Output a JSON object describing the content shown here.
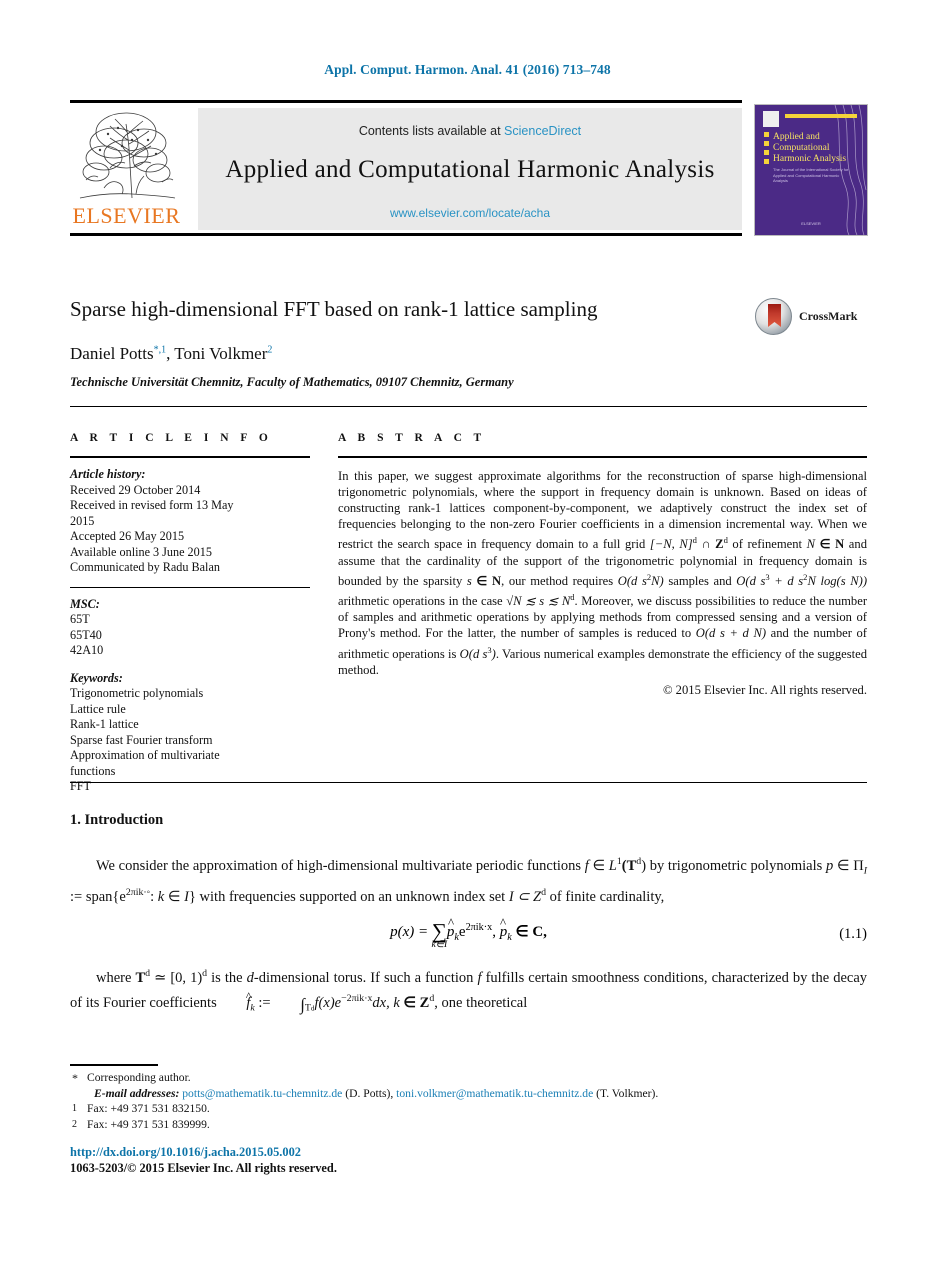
{
  "running_head": "Appl. Comput. Harmon. Anal. 41 (2016) 713–748",
  "masthead": {
    "contents_prefix": "Contents lists available at ",
    "contents_link": "ScienceDirect",
    "journal_title": "Applied and Computational Harmonic Analysis",
    "journal_url": "www.elsevier.com/locate/acha",
    "publisher_logo_text": "ELSEVIER",
    "cover": {
      "title": "Applied and Computational Harmonic Analysis",
      "subtitle": "The Journal of the International Society for Applied and Computational Harmonic Analysis",
      "footer": "ELSEVIER"
    }
  },
  "article": {
    "title": "Sparse high-dimensional FFT based on rank-1 lattice sampling",
    "crossmark_label": "CrossMark",
    "authors": "Daniel Potts",
    "author1_marks": "*,1",
    "authors_second": ", Toni Volkmer",
    "author2_marks": "2",
    "affiliation": "Technische Universität Chemnitz, Faculty of Mathematics, 09107 Chemnitz, Germany"
  },
  "info": {
    "heading": "A R T I C L E   I N F O",
    "history_label": "Article history:",
    "history": [
      "Received 29 October 2014",
      "Received in revised form 13 May",
      "2015",
      "Accepted 26 May 2015",
      "Available online 3 June 2015",
      "Communicated by Radu Balan"
    ],
    "msc_label": "MSC:",
    "msc": [
      "65T",
      "65T40",
      "42A10"
    ],
    "keywords_label": "Keywords:",
    "keywords": [
      "Trigonometric polynomials",
      "Lattice rule",
      "Rank-1 lattice",
      "Sparse fast Fourier transform",
      "Approximation of multivariate",
      "functions",
      "FFT"
    ]
  },
  "abstract": {
    "heading": "A B S T R A C T",
    "p1_a": "In this paper, we suggest approximate algorithms for the reconstruction of sparse high-dimensional trigonometric polynomials, where the support in frequency domain is unknown. Based on ideas of constructing rank-1 lattices component-by-component, we adaptively construct the index set of frequencies belonging to the non-zero Fourier coefficients in a dimension incremental way. When we restrict the search space in frequency domain to a full grid ",
    "p1_grid": "[−N, N]",
    "p1_grid_sup": "d",
    "p1_cap": " ∩ ",
    "p1_Z": "Z",
    "p1_Z_sup": "d",
    "p1_b": " of refinement ",
    "p1_N": "N",
    "p1_in_N": " ∈ N",
    "p1_c": " and assume that the cardinality of the support of the trigonometric polynomial in frequency domain is bounded by the sparsity ",
    "p1_s": "s",
    "p1_sinN": " ∈ N",
    "p1_d": ", our method requires ",
    "p1_O1": "O(d s",
    "p1_O1_sup": "2",
    "p1_O1_tail": "N)",
    "p1_e": " samples and ",
    "p1_O2a": "O(d s",
    "p1_O2a_sup": "3",
    "p1_O2b": " + d s",
    "p1_O2b_sup": "2",
    "p1_O2c": "N log(s N))",
    "p1_f": " arithmetic operations in the case ",
    "p1_sqrt": "√N ≲ s ≲ N",
    "p1_sqrt_sup": "d",
    "p1_g": ". Moreover, we discuss possibilities to reduce the number of samples and arithmetic operations by applying methods from compressed sensing and a version of Prony's method. For the latter, the number of samples is reduced to ",
    "p1_O3": "O(d s + d N)",
    "p1_h": " and the number of arithmetic operations is ",
    "p1_O4": "O(d s",
    "p1_O4_sup": "3",
    "p1_O4_tail": ")",
    "p1_i": ". Various numerical examples demonstrate the efficiency of the suggested method.",
    "copyright": "© 2015 Elsevier Inc. All rights reserved."
  },
  "body": {
    "section_heading": "1. Introduction",
    "p1_a": "We consider the approximation of high-dimensional multivariate periodic functions ",
    "p1_f": "f",
    "p1_b": " ∈ ",
    "p1_L": "L",
    "p1_L_sup": "1",
    "p1_T": "(T",
    "p1_T_sup": "d",
    "p1_T_end": ")",
    "p1_c": " by trigonometric polynomials ",
    "p1_p": "p",
    "p1_d": " ∈ ",
    "p1_Pi": "Π",
    "p1_Pi_sub": "I",
    "p1_e": " := span{e",
    "p1_exp": "2πik·◦",
    "p1_f2": ": ",
    "p1_k": "k",
    "p1_g": " ∈ ",
    "p1_I": "I",
    "p1_h": "} with frequencies supported on an unknown index set ",
    "p1_Iset": "I ⊂ Z",
    "p1_Iset_sup": "d",
    "p1_i": " of finite cardinality,",
    "eq_number": "(1.1)",
    "eq_lhs": "p(x) = ",
    "eq_sum_limit": "k∈I",
    "eq_coef": "p",
    "eq_coef_sub": "k",
    "eq_exp_base": "e",
    "eq_exp": "2πik·x",
    "eq_mid": ",    ",
    "eq_coef2": "p",
    "eq_coef2_sub": "k",
    "eq_rhs": " ∈ C,",
    "p2_a": "where ",
    "p2_T": "T",
    "p2_T_sup": "d",
    "p2_b": " ≃ [0, 1)",
    "p2_b_sup": "d",
    "p2_c": " is the ",
    "p2_d": "d",
    "p2_e": "-dimensional torus. If such a function ",
    "p2_f": "f",
    "p2_g": " fulfills certain smoothness conditions, characterized by the decay of its Fourier coefficients ",
    "p2_fhat": "f",
    "p2_fhat_sub": "k",
    "p2_h": " := ",
    "p2_int": "∫",
    "p2_int_sub": "T",
    "p2_int_sub_sup": "d",
    "p2_i": "f(x)e",
    "p2_exp": "−2πik·x",
    "p2_j": "dx, ",
    "p2_k": "k",
    "p2_l": " ∈ Z",
    "p2_l_sup": "d",
    "p2_m": ", one theoretical"
  },
  "footnotes": {
    "corresponding_mark": "*",
    "corresponding": "Corresponding author.",
    "email_label": "E-mail addresses:",
    "email1": "potts@mathematik.tu-chemnitz.de",
    "email1_who": "(D. Potts),",
    "email2": "toni.volkmer@mathematik.tu-chemnitz.de",
    "email2_who": "(T. Volkmer).",
    "fn1_mark": "1",
    "fn1": "Fax: +49 371 531 832150.",
    "fn2_mark": "2",
    "fn2": "Fax: +49 371 531 839999."
  },
  "footer": {
    "doi": "http://dx.doi.org/10.1016/j.acha.2015.05.002",
    "issn": "1063-5203/© 2015 Elsevier Inc. All rights reserved."
  },
  "colors": {
    "link_blue": "#0d74a8",
    "link_light": "#2a93c4",
    "elsevier_orange": "#e87722",
    "cover_purple": "#4b2a86",
    "cover_yellow": "#f5d33a"
  }
}
